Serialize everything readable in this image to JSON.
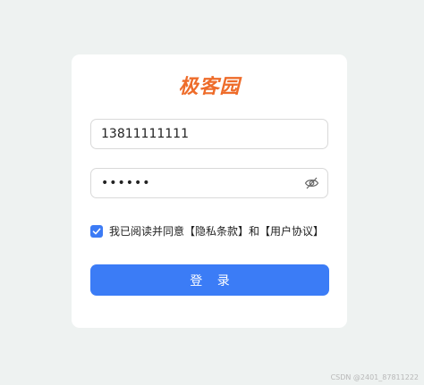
{
  "brand": {
    "logo_text": "极客园",
    "logo_color": "#ee6c2a"
  },
  "form": {
    "phone": {
      "value": "13811111111",
      "icon": null
    },
    "password": {
      "value": "••••••",
      "toggle_icon": "eye-off-icon"
    },
    "agreement": {
      "checked": true,
      "text_prefix": "我已阅读并同意",
      "privacy_link": "【隐私条款】",
      "conjunction": "和",
      "user_agreement_link": "【用户协议】"
    },
    "submit_label": "登 录"
  },
  "colors": {
    "background": "#eef2f1",
    "primary": "#3b7cf6",
    "accent": "#ee6c2a"
  },
  "watermark": "CSDN @2401_87811222"
}
